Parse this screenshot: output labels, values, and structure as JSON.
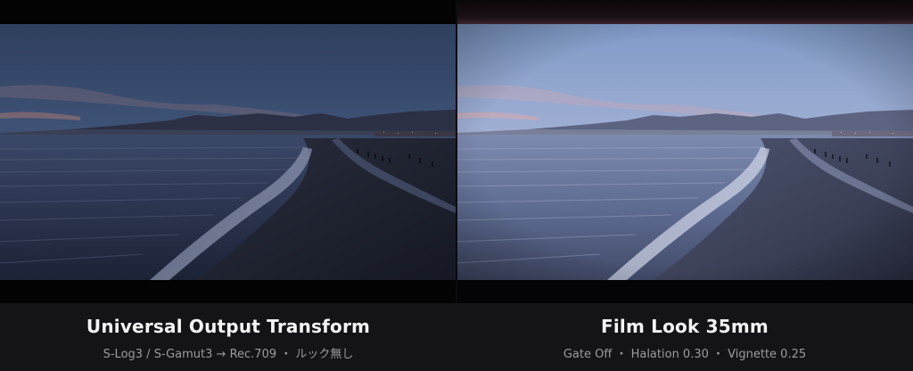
{
  "comparison": {
    "left": {
      "title": "Universal Output Transform",
      "subtitle": "S-Log3 / S-Gamut3 → Rec.709 ・ ルック無し",
      "image_desc": "dusk-beach-photo-neutral"
    },
    "right": {
      "title": "Film Look 35mm",
      "subtitle": "Gate Off ・ Halation 0.30 ・ Vignette 0.25",
      "image_desc": "dusk-beach-photo-film-look"
    }
  },
  "colors": {
    "background": "#000000",
    "caption_bar": "#141416",
    "title_text": "#f4f4f5",
    "subtitle_text": "#9a9aa0"
  }
}
